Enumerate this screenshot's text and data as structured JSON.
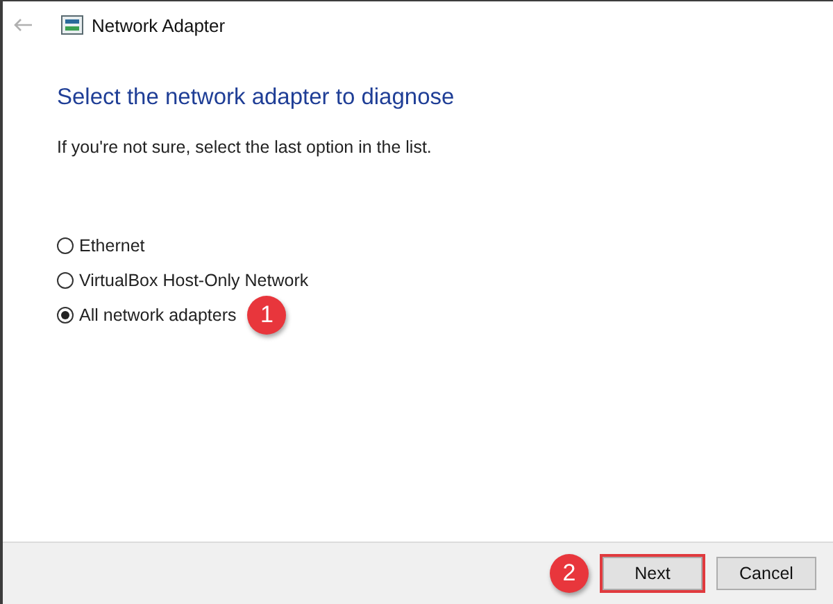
{
  "window": {
    "title": "Network Adapter"
  },
  "heading": "Select the network adapter to diagnose",
  "instruction": "If you're not sure, select the last option in the list.",
  "options": [
    {
      "label": "Ethernet",
      "selected": false
    },
    {
      "label": "VirtualBox Host-Only Network",
      "selected": false
    },
    {
      "label": "All network adapters",
      "selected": true,
      "callout": "1"
    }
  ],
  "buttons": [
    {
      "label": "Next",
      "highlighted": true,
      "callout": "2"
    },
    {
      "label": "Cancel",
      "highlighted": false
    }
  ]
}
